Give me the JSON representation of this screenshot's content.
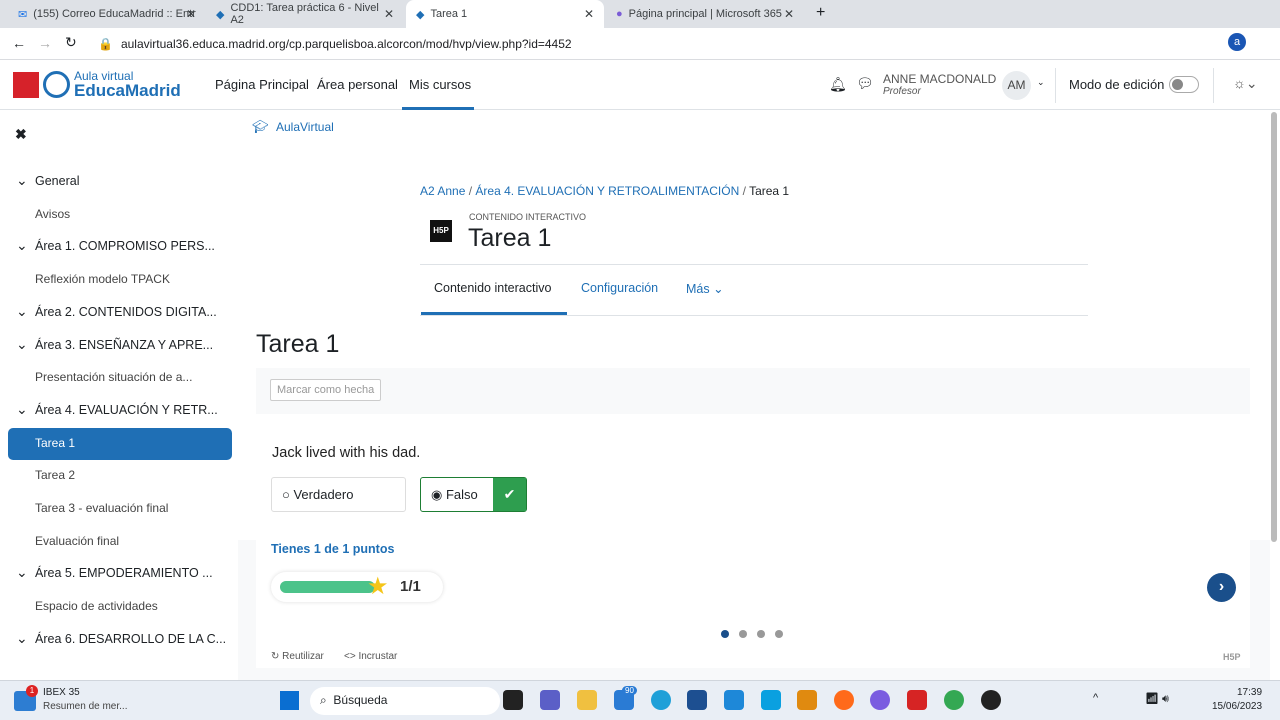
{
  "browser": {
    "tabs": [
      {
        "label": "(155) Correo EducaMadrid :: Entr"
      },
      {
        "label": "CDD1: Tarea práctica 6 - Nivel A2"
      },
      {
        "label": "Tarea 1"
      },
      {
        "label": "Página principal | Microsoft 365"
      }
    ],
    "url": "aulavirtual36.educa.madrid.org/cp.parquelisboa.alcorcon/mod/hvp/view.php?id=4452"
  },
  "header": {
    "logo_top": "Aula virtual",
    "logo_bottom": "EducaMadrid",
    "nav": [
      "Página Principal",
      "Área personal",
      "Mis cursos"
    ],
    "user_name": "ANNE MACDONALD",
    "user_role": "Profesor",
    "avatar": "AM",
    "edit_mode": "Modo de edición",
    "edit_mode_on": false
  },
  "sidebar": {
    "items": [
      {
        "label": "General",
        "section": true
      },
      {
        "label": "Avisos"
      },
      {
        "label": "Área 1. COMPROMISO PERS...",
        "section": true
      },
      {
        "label": "Reflexión modelo TPACK"
      },
      {
        "label": "Área 2. CONTENIDOS DIGITA...",
        "section": true
      },
      {
        "label": "Área 3. ENSEÑANZA Y APRE...",
        "section": true
      },
      {
        "label": "Presentación situación de a..."
      },
      {
        "label": "Área 4. EVALUACIÓN Y RETR...",
        "section": true
      },
      {
        "label": "Tarea 1",
        "active": true
      },
      {
        "label": "Tarea 2"
      },
      {
        "label": "Tarea 3 - evaluación final"
      },
      {
        "label": "Evaluación final"
      },
      {
        "label": "Área 5. EMPODERAMIENTO ...",
        "section": true
      },
      {
        "label": "Espacio de actividades"
      },
      {
        "label": "Área 6. DESARROLLO DE LA C...",
        "section": true
      }
    ]
  },
  "main": {
    "aulavirtual": "AulaVirtual",
    "breadcrumb": [
      "A2 Anne",
      "Área 4. EVALUACIÓN Y RETROALIMENTACIÓN",
      "Tarea 1"
    ],
    "kicker": "CONTENIDO INTERACTIVO",
    "title": "Tarea 1",
    "tabs": [
      "Contenido interactivo",
      "Configuración",
      "Más"
    ],
    "heading": "Tarea 1",
    "mark_done": "Marcar como hecha",
    "question": "Jack lived with his dad.",
    "options": [
      "Verdadero",
      "Falso"
    ],
    "selected": "Falso",
    "score_text": "Tienes 1 de 1 puntos",
    "score": "1/1",
    "score_fraction": 1,
    "reuse": "Reutilizar",
    "embed": "Incrustar",
    "h5p": "H5P",
    "slides": 4,
    "current_slide": 1
  },
  "taskbar": {
    "widget_title": "IBEX 35",
    "widget_sub": "Resumen de mer...",
    "search": "Búsqueda",
    "mail_badge": "90",
    "time": "17:39",
    "date": "15/06/2023"
  }
}
